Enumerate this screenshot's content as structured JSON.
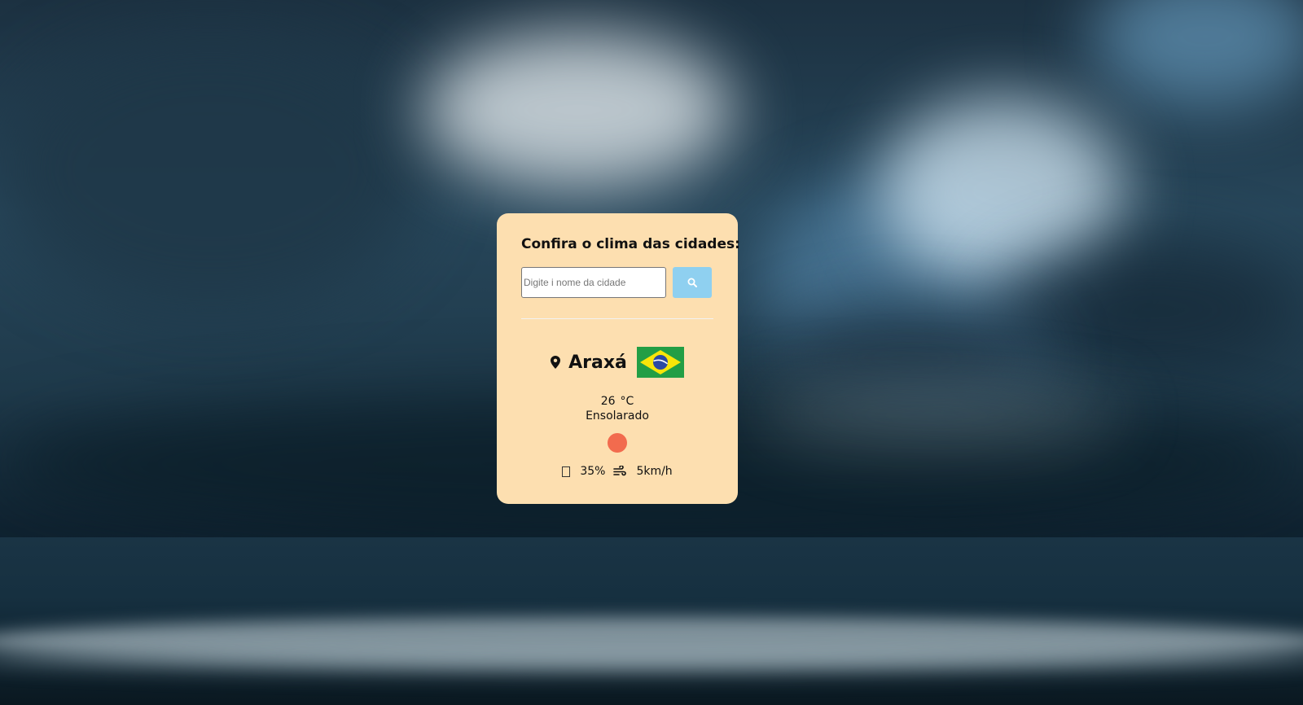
{
  "card": {
    "title": "Confira o clima das cidades:",
    "search": {
      "placeholder": "Digite i nome da cidade",
      "button_icon": "search-icon"
    },
    "location": {
      "icon": "map-pin-icon",
      "city": "Araxá",
      "flag": "brazil-flag"
    },
    "weather": {
      "temperature": "26",
      "unit": "°C",
      "description": "Ensolarado",
      "icon": "sun-icon",
      "humidity_icon": "humidity-icon",
      "humidity": "35%",
      "wind_icon": "wind-icon",
      "wind": "5km/h"
    }
  },
  "colors": {
    "card_background": "#fddfb0",
    "search_button": "#8fd0f0",
    "weather_icon": "#f26b4e"
  }
}
